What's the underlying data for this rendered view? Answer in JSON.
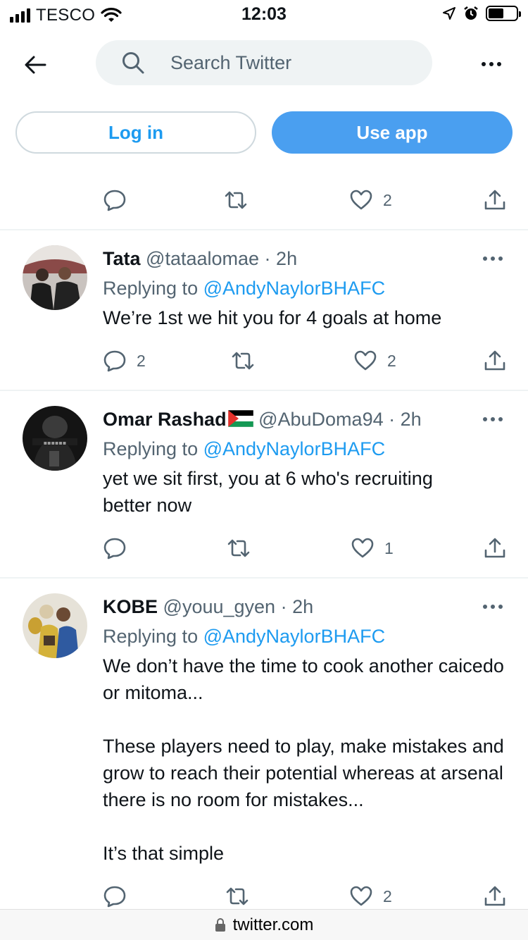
{
  "status_bar": {
    "carrier": "TESCO",
    "time": "12:03"
  },
  "header": {
    "search_placeholder": "Search Twitter"
  },
  "auth": {
    "login_label": "Log in",
    "use_app_label": "Use app"
  },
  "top_actions": {
    "reply_count": "",
    "retweet_count": "",
    "like_count": "2"
  },
  "tweets": [
    {
      "name": "Tata",
      "handle": "@tataalomae",
      "time": "2h",
      "replying_prefix": "Replying to ",
      "replying_to": "@AndyNaylorBHAFC",
      "text": "We’re 1st we hit you for 4 goals at home",
      "reply_count": "2",
      "retweet_count": "",
      "like_count": "2"
    },
    {
      "name": "Omar Rashad",
      "handle": "@AbuDoma94",
      "time": "2h",
      "replying_prefix": "Replying to ",
      "replying_to": "@AndyNaylorBHAFC",
      "text": "yet we sit first, you at 6 who's recruiting better now",
      "reply_count": "",
      "retweet_count": "",
      "like_count": "1"
    },
    {
      "name": "KOBE",
      "handle": "@youu_gyen",
      "time": "2h",
      "replying_prefix": "Replying to ",
      "replying_to": "@AndyNaylorBHAFC",
      "text": "We don’t have the time to cook another caicedo or mitoma...\n\nThese players need to play, make mistakes and grow to reach their potential whereas at arsenal there is no room for mistakes...\n\nIt’s that simple",
      "reply_count": "",
      "retweet_count": "",
      "like_count": "2"
    }
  ],
  "url_bar": {
    "url": "twitter.com"
  },
  "colors": {
    "accent": "#1d9bf0",
    "button_blue": "#4a9ff0",
    "muted_text": "#536471",
    "divider": "#eff3f4"
  }
}
